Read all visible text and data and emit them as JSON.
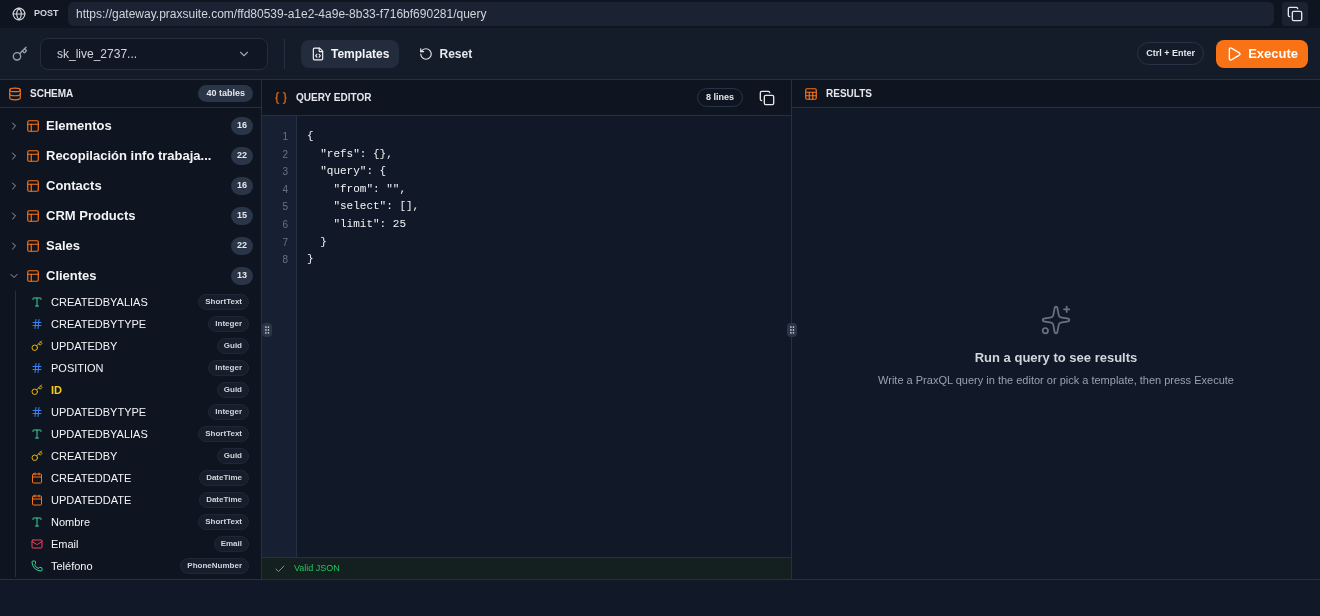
{
  "request": {
    "method": "POST",
    "url": "https://gateway.praxsuite.com/ffd80539-a1e2-4a9e-8b33-f716bf690281/query"
  },
  "toolbar": {
    "api_key": "sk_live_2737...",
    "templates": "Templates",
    "reset": "Reset",
    "shortcut": "Ctrl + Enter",
    "execute": "Execute"
  },
  "schema": {
    "title": "SCHEMA",
    "count": "40 tables",
    "tables": [
      {
        "name": "Elementos",
        "count": "16",
        "expanded": false
      },
      {
        "name": "Recopilación info trabaja...",
        "count": "22",
        "expanded": false
      },
      {
        "name": "Contacts",
        "count": "16",
        "expanded": false
      },
      {
        "name": "CRM Products",
        "count": "15",
        "expanded": false
      },
      {
        "name": "Sales",
        "count": "22",
        "expanded": false
      },
      {
        "name": "Clientes",
        "count": "13",
        "expanded": true,
        "children": [
          {
            "kind": "text",
            "name": "CREATEDBYALIAS",
            "type": "ShortText",
            "primary": false
          },
          {
            "kind": "number",
            "name": "CREATEDBYTYPE",
            "type": "Integer",
            "primary": false
          },
          {
            "kind": "key",
            "name": "UPDATEDBY",
            "type": "Guid",
            "primary": false
          },
          {
            "kind": "number",
            "name": "POSITION",
            "type": "Integer",
            "primary": false
          },
          {
            "kind": "key",
            "name": "ID",
            "type": "Guid",
            "primary": true
          },
          {
            "kind": "number",
            "name": "UPDATEDBYTYPE",
            "type": "Integer",
            "primary": false
          },
          {
            "kind": "text",
            "name": "UPDATEDBYALIAS",
            "type": "ShortText",
            "primary": false
          },
          {
            "kind": "key",
            "name": "CREATEDBY",
            "type": "Guid",
            "primary": false
          },
          {
            "kind": "date",
            "name": "CREATEDDATE",
            "type": "DateTime",
            "primary": false
          },
          {
            "kind": "date",
            "name": "UPDATEDDATE",
            "type": "DateTime",
            "primary": false
          },
          {
            "kind": "text",
            "name": "Nombre",
            "type": "ShortText",
            "primary": false
          },
          {
            "kind": "email",
            "name": "Email",
            "type": "Email",
            "primary": false
          },
          {
            "kind": "phone",
            "name": "Teléfono",
            "type": "PhoneNumber",
            "primary": false
          }
        ]
      }
    ]
  },
  "editor": {
    "title": "QUERY EDITOR",
    "line_count": "8 lines",
    "lines": [
      {
        "number": "1",
        "text": "{"
      },
      {
        "number": "2",
        "text": "  \"refs\": {},"
      },
      {
        "number": "3",
        "text": "  \"query\": {"
      },
      {
        "number": "4",
        "text": "    \"from\": \"\","
      },
      {
        "number": "5",
        "text": "    \"select\": [],"
      },
      {
        "number": "6",
        "text": "    \"limit\": 25"
      },
      {
        "number": "7",
        "text": "  }"
      },
      {
        "number": "8",
        "text": "}"
      }
    ],
    "status": "Valid JSON"
  },
  "results": {
    "title": "RESULTS",
    "empty_title": "Run a query to see results",
    "empty_hint": "Write a PraxQL query in the editor or pick a template, then press Execute"
  }
}
